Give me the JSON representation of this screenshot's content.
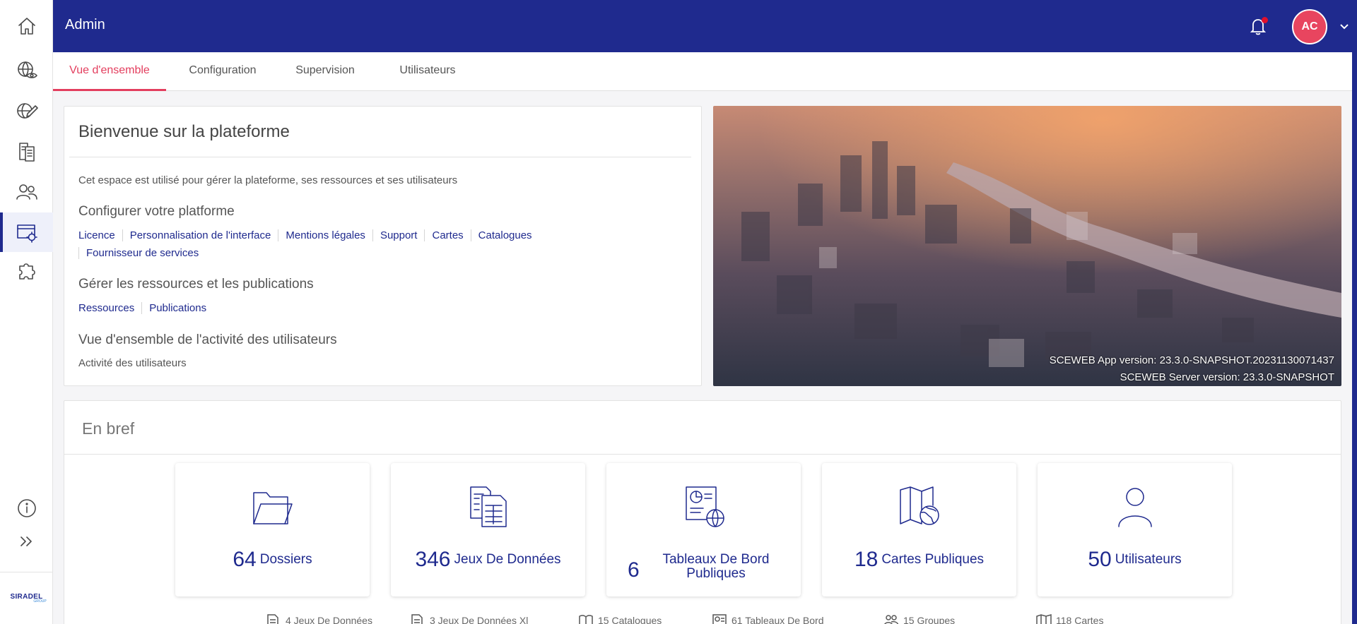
{
  "sidebar": {
    "items": [
      {
        "icon": "home-icon"
      },
      {
        "icon": "globe-eye-icon"
      },
      {
        "icon": "globe-pen-icon"
      },
      {
        "icon": "documents-icon"
      },
      {
        "icon": "users-icon"
      },
      {
        "icon": "admin-settings-icon",
        "active": true
      },
      {
        "icon": "puzzle-icon"
      },
      {
        "icon": "info-icon"
      },
      {
        "icon": "expand-icon"
      }
    ],
    "logo": "SIRADEL",
    "logo_sub": "GROUP"
  },
  "topbar": {
    "title": "Admin",
    "avatar_initials": "AC"
  },
  "tabs": [
    {
      "label": "Vue d'ensemble",
      "active": true
    },
    {
      "label": "Configuration"
    },
    {
      "label": "Supervision"
    },
    {
      "label": "Utilisateurs"
    }
  ],
  "welcome": {
    "title": "Bienvenue sur la plateforme",
    "description": "Cet espace est utilisé pour gérer la plateforme, ses ressources et ses utilisateurs",
    "configure_heading": "Configurer votre platforme",
    "configure_links": [
      "Licence",
      "Personnalisation de l'interface",
      "Mentions légales",
      "Support",
      "Cartes",
      "Catalogues",
      "Fournisseur de services"
    ],
    "resources_heading": "Gérer les ressources et les publications",
    "resources_links": [
      "Ressources",
      "Publications"
    ],
    "activity_heading": "Vue d'ensemble de l'activité des utilisateurs",
    "activity_link": "Activité des utilisateurs"
  },
  "versions": {
    "app": "SCEWEB App version: 23.3.0-SNAPSHOT.20231130071437",
    "server": "SCEWEB Server version: 23.3.0-SNAPSHOT"
  },
  "brief": {
    "title": "En bref",
    "cards": [
      {
        "value": "64",
        "label": "Dossiers",
        "icon": "folder-icon"
      },
      {
        "value": "346",
        "label": "Jeux De Données",
        "icon": "datasets-icon"
      },
      {
        "value": "6",
        "label": "Tableaux De Bord Publiques",
        "icon": "dashboard-icon"
      },
      {
        "value": "18",
        "label": "Cartes Publiques",
        "icon": "map-globe-icon"
      },
      {
        "value": "50",
        "label": "Utilisateurs",
        "icon": "user-icon"
      }
    ],
    "footer": [
      {
        "text": "4 Jeux De Données",
        "icon": "dataset-small-icon"
      },
      {
        "text": "3 Jeux De Données Xl",
        "icon": "dataset-xl-small-icon"
      },
      {
        "text": "15 Catalogues",
        "icon": "catalogue-small-icon"
      },
      {
        "text": "61 Tableaux De Bord",
        "icon": "dashboard-small-icon"
      },
      {
        "text": "15 Groupes",
        "icon": "groups-small-icon"
      },
      {
        "text": "118 Cartes",
        "icon": "map-small-icon"
      }
    ]
  }
}
